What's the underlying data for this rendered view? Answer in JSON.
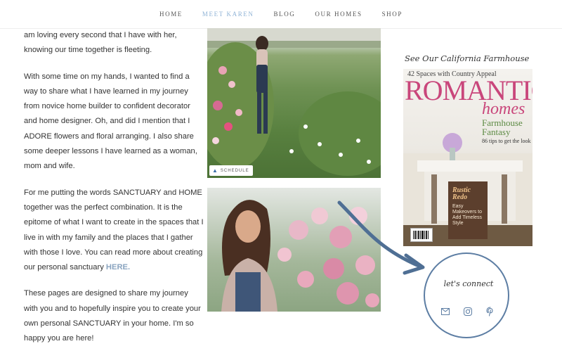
{
  "nav": {
    "items": [
      {
        "label": "HOME",
        "active": false
      },
      {
        "label": "MEET KAREN",
        "active": true
      },
      {
        "label": "BLOG",
        "active": false
      },
      {
        "label": "OUR HOMES",
        "active": false
      },
      {
        "label": "SHOP",
        "active": false
      }
    ],
    "active_color": "#8fb3d6"
  },
  "content": {
    "p1": "am loving every second that I have with her, knowing our time together is fleeting.",
    "p2": "With some time on my hands, I wanted to find a way to share what I have learned in my journey from novice home builder to confident decorator and home designer.  Oh, and did I mention that I ADORE flowers and floral arranging. I also share some deeper lessons I have learned as a woman, mom and wife.",
    "p3_text": "For me putting the words SANCTUARY and HOME together was the perfect combination. It is the epitome of what I want to create in the spaces that I live in with my family and the places that I gather with those I love.  You can read more about creating our personal sanctuary ",
    "p3_link": "HERE.",
    "p4": "These pages are designed to share my journey with you and to  hopefully  inspire you to create your own personal SANCTUARY in your home. I'm so happy you are here!"
  },
  "photos": {
    "badge_label": "SCHEDULE"
  },
  "sidebar": {
    "heading": "See Our California Farmhouse",
    "magazine": {
      "top_line": "42 Spaces with Country Appeal",
      "title": "ROMANTIC",
      "subtitle": "homes",
      "feature": "Farmhouse Fantasy",
      "feature_tips": "86 tips to get the look",
      "box_title": "Rustic Redo",
      "box_text": "Easy Makeovers to Add Timeless Style"
    },
    "connect_label": "let's connect",
    "social_icons": [
      "mail-icon",
      "instagram-icon",
      "pinterest-icon"
    ],
    "accent_color": "#5c7da3"
  }
}
